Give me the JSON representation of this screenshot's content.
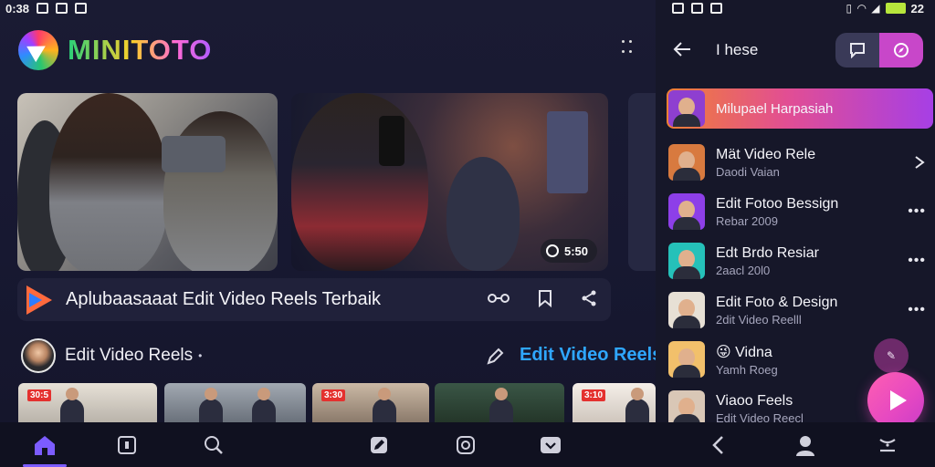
{
  "status_left": {
    "time": "0:38"
  },
  "status_right": {
    "battery": "22"
  },
  "brand": {
    "name": "MINITOTO"
  },
  "featured": {
    "duration": "5:50"
  },
  "caption": {
    "text": "Aplubaasaaat Edit Video Reels Terbaik"
  },
  "section": {
    "title": "Edit Video Reels",
    "link_text": "Edit Video Reels"
  },
  "strip_tags": [
    "30:5",
    "",
    "3:30",
    "",
    "3:10"
  ],
  "right_panel": {
    "title": "I hese",
    "items": [
      {
        "name": "Milupael Harpasiah",
        "sub": "",
        "highlight": true,
        "action": "none",
        "avatar_color": "#8e3fd0"
      },
      {
        "name": "Mät Video Rele",
        "sub": "Daodi Vaian",
        "highlight": false,
        "action": "chevron",
        "avatar_color": "#d87a3f"
      },
      {
        "name": "Edit Fotoo Bessign",
        "sub": "Rebar 2009",
        "highlight": false,
        "action": "more",
        "avatar_color": "#8d3fe8"
      },
      {
        "name": "Edt Brdo Resiar",
        "sub": "2aacl 20l0",
        "highlight": false,
        "action": "more",
        "avatar_color": "#25c1b9"
      },
      {
        "name": "Edit Foto & Design",
        "sub": "2dit Video Reelll",
        "highlight": false,
        "action": "more",
        "avatar_color": "#e7e0d5"
      },
      {
        "name": "😜 Vidna",
        "sub": "Yamh Roeg",
        "highlight": false,
        "action": "none",
        "avatar_color": "#f2c06b"
      },
      {
        "name": "Viaoo Feels",
        "sub": "Edit Video Reecl",
        "highlight": false,
        "action": "none",
        "avatar_color": "#d9c7b6"
      }
    ]
  },
  "colors": {
    "accent": "#c847c9",
    "link": "#2fa7ff",
    "nav_active": "#7c5cff"
  }
}
